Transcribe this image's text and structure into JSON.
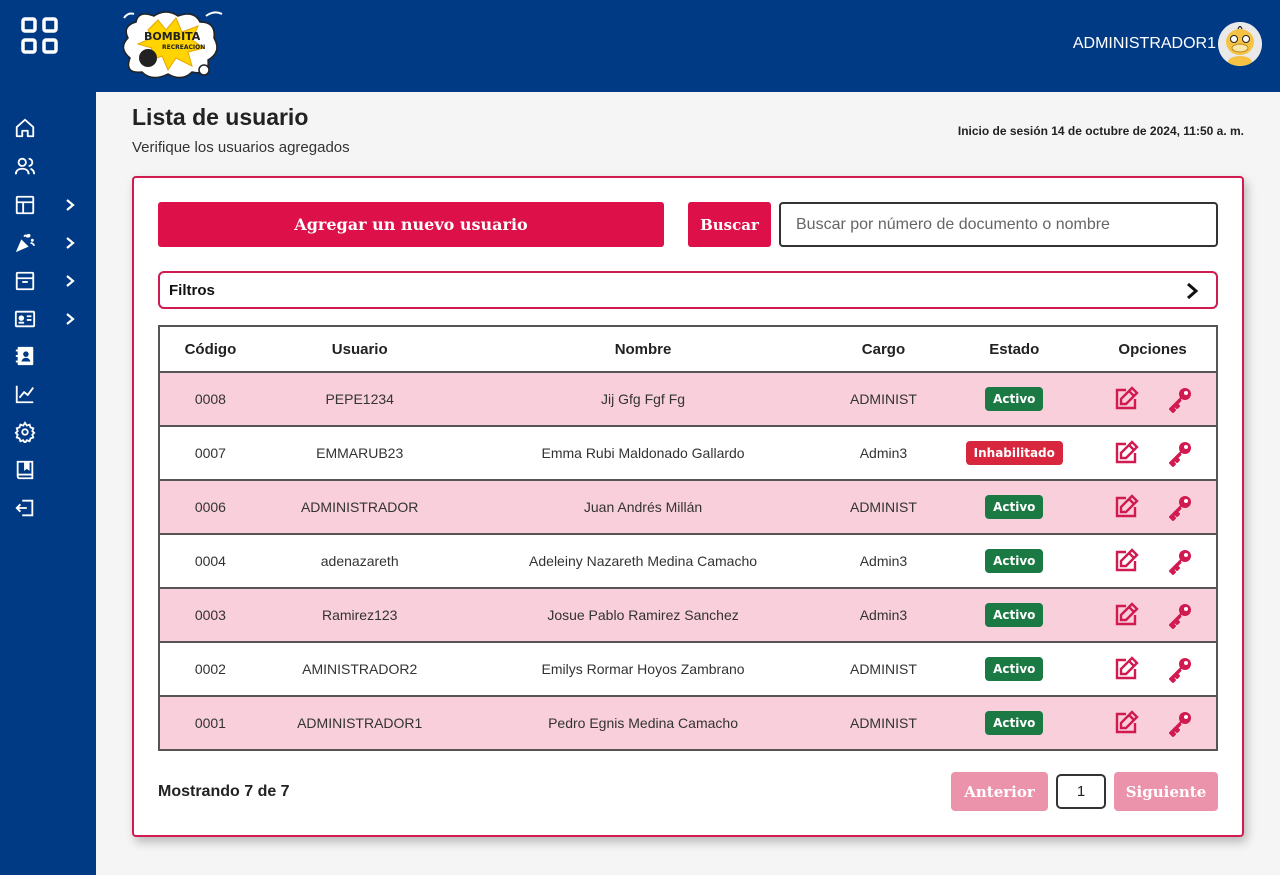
{
  "header": {
    "logo_text": "BOMBITA RECREACION",
    "admin_name": "ADMINISTRADOR1"
  },
  "sidebar": {
    "items": [
      {
        "icon": "home-icon",
        "expandable": false
      },
      {
        "icon": "users-icon",
        "expandable": false
      },
      {
        "icon": "layout-icon",
        "expandable": true
      },
      {
        "icon": "party-icon",
        "expandable": true
      },
      {
        "icon": "archive-icon",
        "expandable": true
      },
      {
        "icon": "id-card-icon",
        "expandable": true
      },
      {
        "icon": "contacts-book-icon",
        "expandable": false
      },
      {
        "icon": "chart-line-icon",
        "expandable": false
      },
      {
        "icon": "settings-icon",
        "expandable": false
      },
      {
        "icon": "book-icon",
        "expandable": false
      },
      {
        "icon": "logout-icon",
        "expandable": false
      }
    ]
  },
  "page": {
    "title": "Lista de usuario",
    "subtitle": "Verifique los usuarios agregados",
    "session_info": "Inicio de sesión 14 de octubre de 2024, 11:50 a. m."
  },
  "toolbar": {
    "add_label": "Agregar un nuevo usuario",
    "search_label": "Buscar",
    "search_placeholder": "Buscar por número de documento o nombre",
    "search_value": ""
  },
  "filters": {
    "label": "Filtros"
  },
  "table": {
    "headers": [
      "Código",
      "Usuario",
      "Nombre",
      "Cargo",
      "Estado",
      "Opciones"
    ],
    "rows": [
      {
        "codigo": "0008",
        "usuario": "PEPE1234",
        "nombre": "Jij Gfg Fgf Fg",
        "cargo": "ADMINIST",
        "estado": "Activo"
      },
      {
        "codigo": "0007",
        "usuario": "EMMARUB23",
        "nombre": "Emma Rubi Maldonado Gallardo",
        "cargo": "Admin3",
        "estado": "Inhabilitado"
      },
      {
        "codigo": "0006",
        "usuario": "ADMINISTRADOR",
        "nombre": "Juan Andrés Millán",
        "cargo": "ADMINIST",
        "estado": "Activo"
      },
      {
        "codigo": "0004",
        "usuario": "adenazareth",
        "nombre": "Adeleiny Nazareth Medina Camacho",
        "cargo": "Admin3",
        "estado": "Activo"
      },
      {
        "codigo": "0003",
        "usuario": "Ramirez123",
        "nombre": "Josue Pablo Ramirez Sanchez",
        "cargo": "Admin3",
        "estado": "Activo"
      },
      {
        "codigo": "0002",
        "usuario": "AMINISTRADOR2",
        "nombre": "Emilys Rormar Hoyos Zambrano",
        "cargo": "ADMINIST",
        "estado": "Activo"
      },
      {
        "codigo": "0001",
        "usuario": "ADMINISTRADOR1",
        "nombre": "Pedro Egnis Medina Camacho",
        "cargo": "ADMINIST",
        "estado": "Activo"
      }
    ]
  },
  "pagination": {
    "showing": "Mostrando 7 de 7",
    "prev_label": "Anterior",
    "page": "1",
    "next_label": "Siguiente"
  },
  "colors": {
    "navy": "#003a84",
    "primary": "#dd1049",
    "row_alt": "#f8cfda",
    "active": "#1b7a43",
    "disabled": "#d7263d",
    "pagination_disabled": "#ec93ac"
  }
}
